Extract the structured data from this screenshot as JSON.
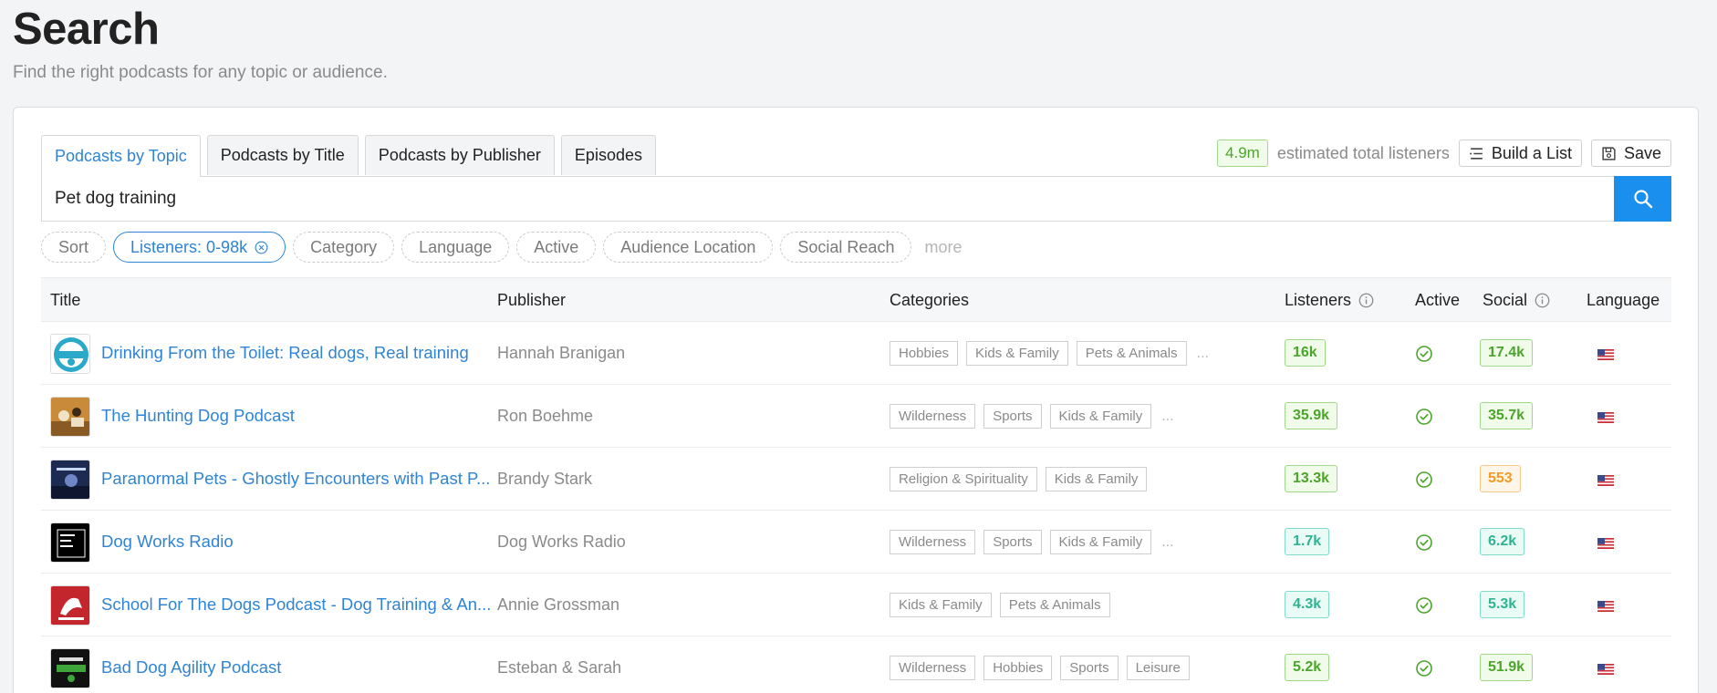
{
  "page": {
    "title": "Search",
    "subtitle": "Find the right podcasts for any topic or audience."
  },
  "tabs": [
    {
      "label": "Podcasts by Topic",
      "active": true
    },
    {
      "label": "Podcasts by Title"
    },
    {
      "label": "Podcasts by Publisher"
    },
    {
      "label": "Episodes"
    }
  ],
  "toolbar": {
    "estimate": "4.9m",
    "estimate_label": "estimated total listeners",
    "build_list_label": "Build a List",
    "save_label": "Save",
    "build_list_icon": "list-icon",
    "save_icon": "save-icon"
  },
  "search": {
    "value": "Pet dog training",
    "icon": "search-icon"
  },
  "filters": {
    "sort": "Sort",
    "listeners": "Listeners: 0-98k",
    "category": "Category",
    "language": "Language",
    "active": "Active",
    "audience_location": "Audience Location",
    "social_reach": "Social Reach",
    "more": "more"
  },
  "columns": {
    "title": "Title",
    "publisher": "Publisher",
    "categories": "Categories",
    "listeners": "Listeners",
    "active": "Active",
    "social": "Social",
    "language": "Language"
  },
  "colors": {
    "accent": "#2f84d4",
    "search_button": "#1a8fee",
    "green": "#4aa52a",
    "teal": "#2fb492",
    "orange": "#f39a24"
  },
  "rows": [
    {
      "title": "Drinking From the Toilet: Real dogs, Real training",
      "publisher": "Hannah Branigan",
      "categories": [
        "Hobbies",
        "Kids & Family",
        "Pets & Animals"
      ],
      "more": "...",
      "listeners": "16k",
      "listeners_tone": "green",
      "social": "17.4k",
      "social_tone": "green",
      "active_icon": "check-circle-icon",
      "language_icon": "us-flag-icon"
    },
    {
      "title": "The Hunting Dog Podcast",
      "publisher": "Ron Boehme",
      "categories": [
        "Wilderness",
        "Sports",
        "Kids & Family"
      ],
      "more": "...",
      "listeners": "35.9k",
      "listeners_tone": "green",
      "social": "35.7k",
      "social_tone": "green",
      "active_icon": "check-circle-icon",
      "language_icon": "us-flag-icon"
    },
    {
      "title": "Paranormal Pets - Ghostly Encounters with Past P...",
      "publisher": "Brandy Stark",
      "categories": [
        "Religion & Spirituality",
        "Kids & Family"
      ],
      "more": "",
      "listeners": "13.3k",
      "listeners_tone": "green",
      "social": "553",
      "social_tone": "orange",
      "active_icon": "check-circle-icon",
      "language_icon": "us-flag-icon"
    },
    {
      "title": "Dog Works Radio",
      "publisher": "Dog Works Radio",
      "categories": [
        "Wilderness",
        "Sports",
        "Kids & Family"
      ],
      "more": "...",
      "listeners": "1.7k",
      "listeners_tone": "teal",
      "social": "6.2k",
      "social_tone": "teal",
      "active_icon": "check-circle-icon",
      "language_icon": "us-flag-icon"
    },
    {
      "title": "School For The Dogs Podcast - Dog Training & An...",
      "publisher": "Annie Grossman",
      "categories": [
        "Kids & Family",
        "Pets & Animals"
      ],
      "more": "",
      "listeners": "4.3k",
      "listeners_tone": "teal",
      "social": "5.3k",
      "social_tone": "teal",
      "active_icon": "check-circle-icon",
      "language_icon": "us-flag-icon"
    },
    {
      "title": "Bad Dog Agility Podcast",
      "publisher": "Esteban & Sarah",
      "categories": [
        "Wilderness",
        "Hobbies",
        "Sports",
        "Leisure"
      ],
      "more": "",
      "listeners": "5.2k",
      "listeners_tone": "green",
      "social": "51.9k",
      "social_tone": "green",
      "active_icon": "check-circle-icon",
      "language_icon": "us-flag-icon"
    }
  ]
}
